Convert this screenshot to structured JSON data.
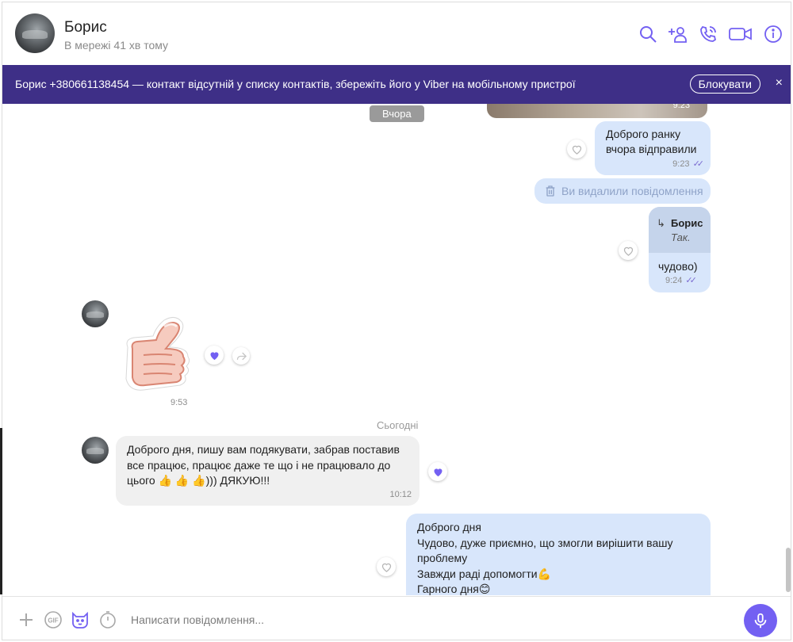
{
  "header": {
    "name": "Борис",
    "status": "В мережі 41 хв тому",
    "icons": [
      "search-icon",
      "add-contact-icon",
      "voice-call-icon",
      "video-call-icon",
      "info-icon"
    ]
  },
  "banner": {
    "text": "Борис +380661138454 — контакт відсутній у списку контактів, збережіть його у Viber на мобільному пристрої",
    "block_label": "Блокувати",
    "close_symbol": "×"
  },
  "chat": {
    "top_image_time": "9:23",
    "date_yesterday": "Вчора",
    "msg_morning": {
      "line1": "Доброго ранку",
      "line2": "вчора відправили",
      "time": "9:23"
    },
    "deleted_text": "Ви видалили повідомлення",
    "reply": {
      "quote_author": "Борис",
      "quote_text": "Так.",
      "text": "чудово)",
      "time": "9:24"
    },
    "sticker_time": "9:53",
    "date_today": "Сьогодні",
    "incoming": {
      "line1": "Доброго дня, пишу вам подякувати, забрав поставив",
      "line2": "все працює, працює даже те що і не працювало до",
      "line3": "цього 👍 👍 👍))) ДЯКУЮ!!!",
      "time": "10:12"
    },
    "outgoing_last": {
      "line1": "Доброго дня",
      "line2": "Чудово, дуже приємно, що змогли вирішити вашу",
      "line3": "проблему",
      "line4": "Завжди раді допомогти💪",
      "line5": "Гарного дня😊"
    },
    "colors": {
      "accent": "#7360f2",
      "outgoing_bubble": "#d8e6fb",
      "incoming_bubble": "#f0f0f0",
      "banner": "#3e2f87"
    }
  },
  "composer": {
    "placeholder": "Написати повідомлення...",
    "icons": [
      "plus-icon",
      "gif-icon",
      "sticker-icon",
      "timer-icon",
      "microphone-icon"
    ]
  }
}
